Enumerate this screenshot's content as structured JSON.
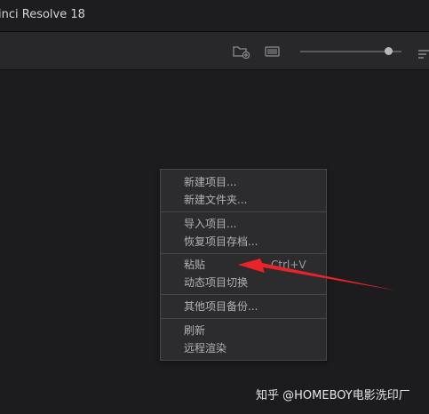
{
  "window": {
    "title": "inci Resolve 18"
  },
  "toolbar": {
    "icons": [
      "new-folder-icon",
      "monitor-view-icon",
      "zoom-slider",
      "sort-icon"
    ],
    "zoom_level": 0.87
  },
  "context_menu": {
    "groups": [
      [
        {
          "label": "新建项目..."
        },
        {
          "label": "新建文件夹..."
        }
      ],
      [
        {
          "label": "导入项目..."
        },
        {
          "label": "恢复项目存档..."
        }
      ],
      [
        {
          "label": "粘贴",
          "shortcut": "Ctrl+V"
        },
        {
          "label": "动态项目切换"
        }
      ],
      [
        {
          "label": "其他项目备份..."
        }
      ],
      [
        {
          "label": "刷新"
        },
        {
          "label": "远程渲染"
        }
      ]
    ]
  },
  "annotation": {
    "arrow_color": "#e8232a"
  },
  "watermark": {
    "text": "知乎 @HOMEBOY电影洗印厂"
  }
}
